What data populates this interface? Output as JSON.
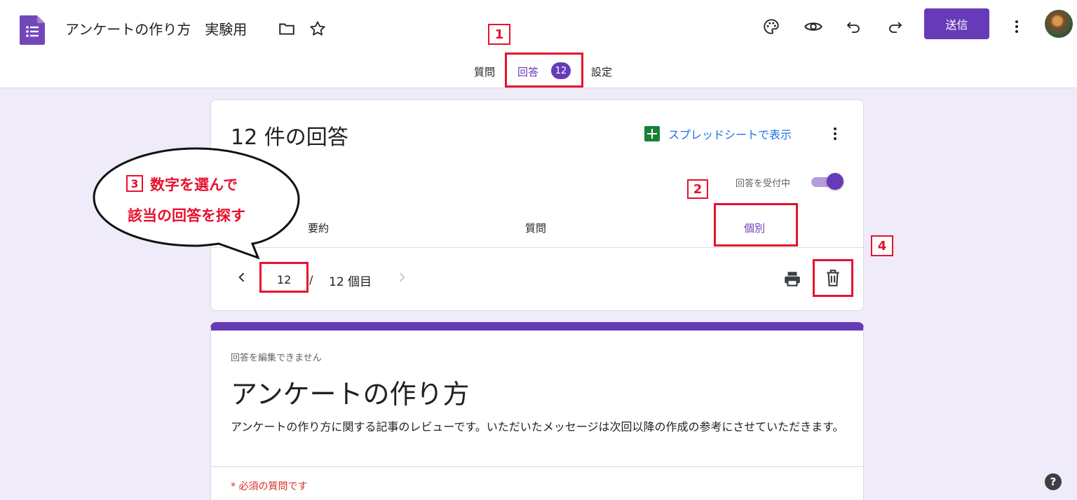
{
  "header": {
    "doc_title": "アンケートの作り方　実験用",
    "send_label": "送信"
  },
  "tabs": [
    {
      "label": "質問"
    },
    {
      "label": "回答",
      "badge": "12"
    },
    {
      "label": "設定"
    }
  ],
  "summary": {
    "count_text": "12 件の回答",
    "sheet_link": "スプレッドシートで表示",
    "accepting_label": "回答を受付中",
    "sub_tabs": [
      "要約",
      "質問",
      "個別"
    ],
    "pager": {
      "current": "12",
      "slash": "/",
      "total": "12 個目"
    }
  },
  "form": {
    "no_edit": "回答を編集できません",
    "title": "アンケートの作り方",
    "description": "アンケートの作り方に関する記事のレビューです。いただいたメッセージは次回以降の作成の参考にさせていただきます。",
    "required_note": "* 必須の質問です"
  },
  "annotations": {
    "n1": "1",
    "n2": "2",
    "n3": "3",
    "n4": "4",
    "bubble_line1": "数字を選んで",
    "bubble_line2": "該当の回答を探す"
  },
  "help_label": "?",
  "colors": {
    "accent": "#673ab7",
    "annotation": "#e8112d",
    "link": "#1a73e8",
    "sheets": "#188038"
  }
}
